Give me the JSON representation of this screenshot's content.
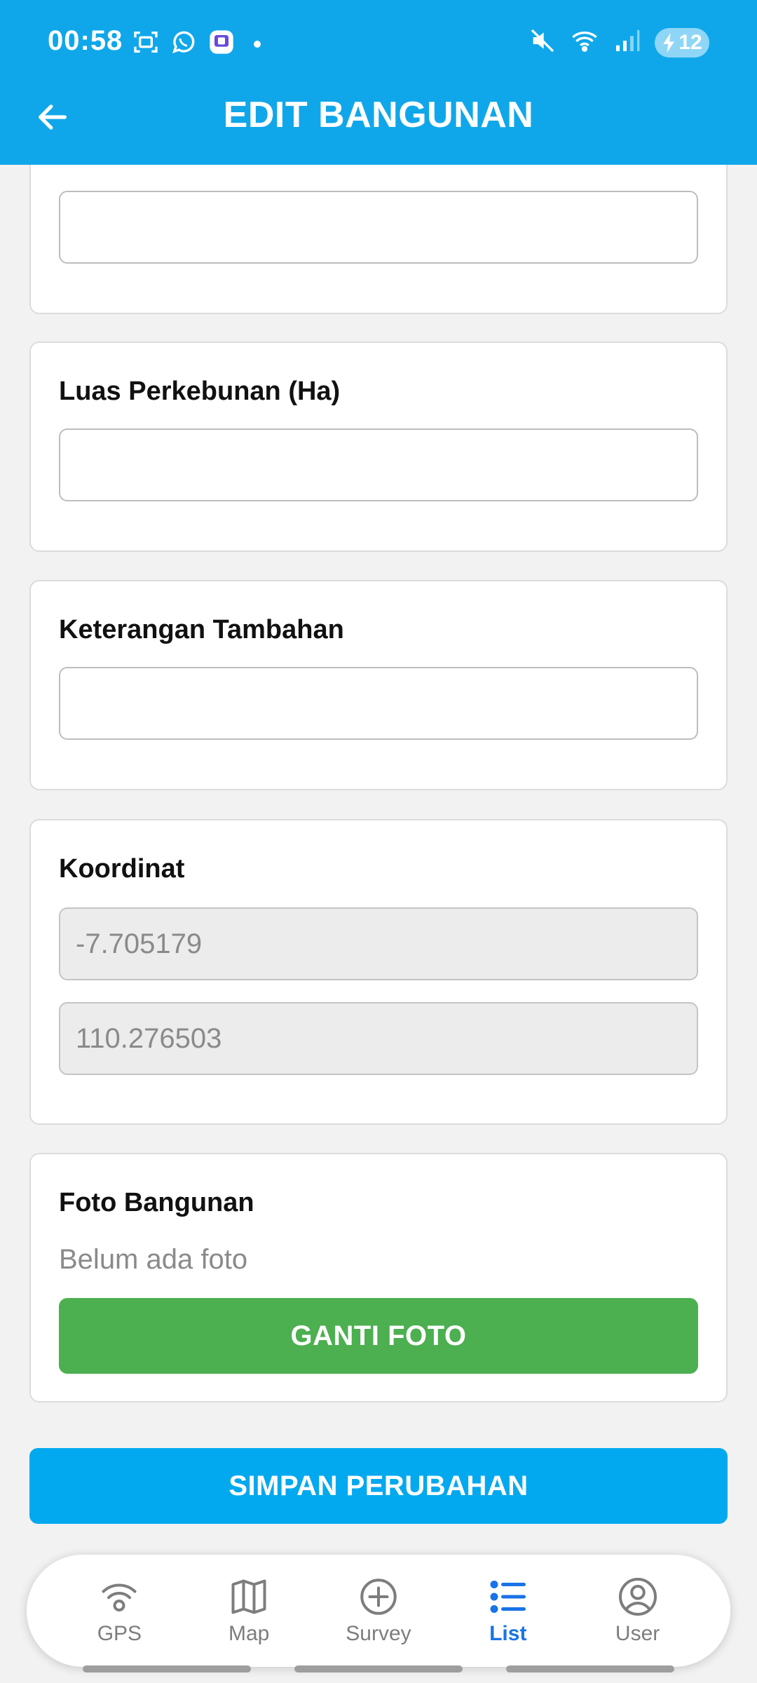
{
  "status_bar": {
    "time": "00:58",
    "battery_level": "12",
    "left_icons": [
      "screenshot-icon",
      "whatsapp-icon",
      "app-notification-icon"
    ],
    "right_icons": [
      "mute-icon",
      "wifi-icon",
      "signal-icon",
      "battery-charging-icon"
    ]
  },
  "app_bar": {
    "title": "EDIT BANGUNAN",
    "back_icon": "arrow-left-icon"
  },
  "form": {
    "partial_field": {
      "value": ""
    },
    "luas_perkebunan": {
      "label": "Luas Perkebunan (Ha)",
      "value": ""
    },
    "keterangan": {
      "label": "Keterangan Tambahan",
      "value": ""
    },
    "koordinat": {
      "label": "Koordinat",
      "latitude": "-7.705179",
      "longitude": "110.276503"
    },
    "foto": {
      "label": "Foto Bangunan",
      "status": "Belum ada foto",
      "button_label": "GANTI FOTO"
    },
    "save_button_label": "SIMPAN PERUBAHAN"
  },
  "bottom_nav": {
    "items": [
      {
        "label": "GPS",
        "icon": "gps-signal-icon",
        "active": false
      },
      {
        "label": "Map",
        "icon": "map-icon",
        "active": false
      },
      {
        "label": "Survey",
        "icon": "plus-circle-icon",
        "active": false
      },
      {
        "label": "List",
        "icon": "list-icon",
        "active": true
      },
      {
        "label": "User",
        "icon": "user-circle-icon",
        "active": false
      }
    ]
  },
  "colors": {
    "primary": "#10a7ea",
    "save_button": "#03a9ef",
    "photo_button": "#4caf50",
    "nav_active": "#1a73e8",
    "nav_inactive": "#7d7d7d"
  }
}
